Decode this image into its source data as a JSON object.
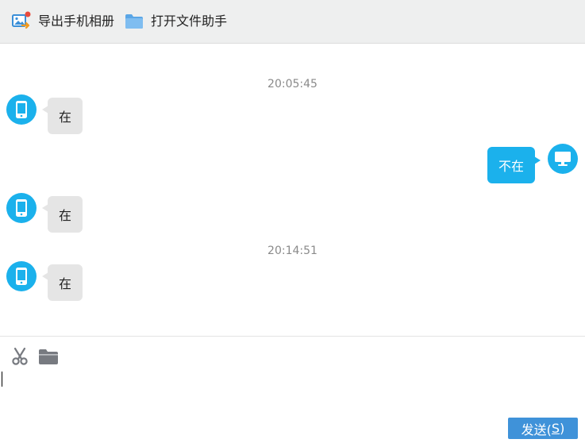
{
  "toolbar": {
    "export_album_label": "导出手机相册",
    "open_file_helper_label": "打开文件助手"
  },
  "messages": [
    {
      "type": "timestamp",
      "text": "20:05:45"
    },
    {
      "type": "in",
      "text": "在"
    },
    {
      "type": "out",
      "text": "不在"
    },
    {
      "type": "in",
      "text": "在"
    },
    {
      "type": "timestamp",
      "text": "20:14:51"
    },
    {
      "type": "in",
      "text": "在"
    }
  ],
  "composer": {
    "value": "",
    "send_label": "发送(",
    "send_hotkey": "S",
    "send_suffix": ")"
  },
  "icons": {
    "toolbar_export": "album-export-icon",
    "toolbar_folder": "folder-icon",
    "avatar_phone": "phone-icon",
    "avatar_desktop": "monitor-icon",
    "scissors": "scissors-icon",
    "folder_tool": "folder-icon"
  },
  "colors": {
    "accent": "#1bb1ec",
    "send_button": "#3f92d9",
    "bubble_in": "#e5e5e5",
    "toolbar_bg": "#eeefef",
    "timestamp_text": "#8a8a8a",
    "notification_dot": "#e84a3c"
  }
}
